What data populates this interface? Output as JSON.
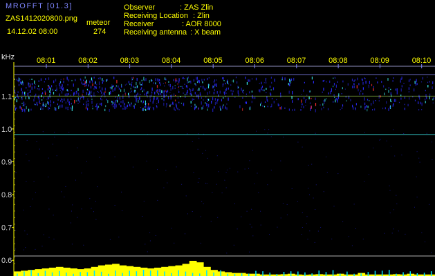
{
  "header": {
    "app_title": "MROFFT [01.3]",
    "file_name": "ZAS1412020800.png",
    "datetime": "14.12.02 08:00",
    "counter_label": "meteor",
    "counter_value": "274",
    "observer_label": "Observer",
    "observer_value": ": ZAS Zlin",
    "location_label": "Receiving Location",
    "location_value": ": Zlin",
    "receiver_label": "Receiver",
    "receiver_value": ": AOR 8000",
    "antenna_label": "Receiving antenna",
    "antenna_value": ": X beam"
  },
  "colors": {
    "text_yellow": "#ffff00",
    "text_blue": "#7f86ff",
    "axis_yellow": "#ffff00",
    "tick_blue": "#7f86ff",
    "signal_blue": "#2a2aff",
    "signal_cyan": "#40ffff",
    "signal_red": "#ff3030",
    "activity_yellow": "#ffff00",
    "activity_cyan": "#00e5ff"
  },
  "chart_data": {
    "type": "heatmap",
    "x_unit": "time",
    "x_ticks": [
      "08:01",
      "08:02",
      "08:03",
      "08:04",
      "08:05",
      "08:06",
      "08:07",
      "08:08",
      "08:09",
      "08:10"
    ],
    "x_range": [
      "08:00",
      "08:10"
    ],
    "y_unit": "kHz",
    "y_ticks": [
      1.1,
      1.0,
      0.9,
      0.8,
      0.7,
      0.6
    ],
    "y_range": [
      0.59,
      1.17
    ],
    "reference_lines_khz": [
      1.165,
      0.983
    ],
    "activity_levels": [
      0.3,
      0.35,
      0.4,
      0.45,
      0.5,
      0.55,
      0.6,
      0.55,
      0.5,
      0.45,
      0.5,
      0.6,
      0.7,
      0.75,
      0.8,
      0.7,
      0.65,
      0.6,
      0.55,
      0.5,
      0.55,
      0.6,
      0.65,
      0.7,
      0.8,
      1.0,
      0.9,
      0.6,
      0.4,
      0.3,
      0.25,
      0.2,
      0.2,
      0.15,
      0.15,
      0.1,
      0.1,
      0.1,
      0.12,
      0.15,
      0.1,
      0.08,
      0.1,
      0.12,
      0.1,
      0.1,
      0.15,
      0.1,
      0.1,
      0.2,
      0.1,
      0.1,
      0.1,
      0.1,
      0.12,
      0.1,
      0.15,
      0.1,
      0.1,
      0.1
    ]
  }
}
